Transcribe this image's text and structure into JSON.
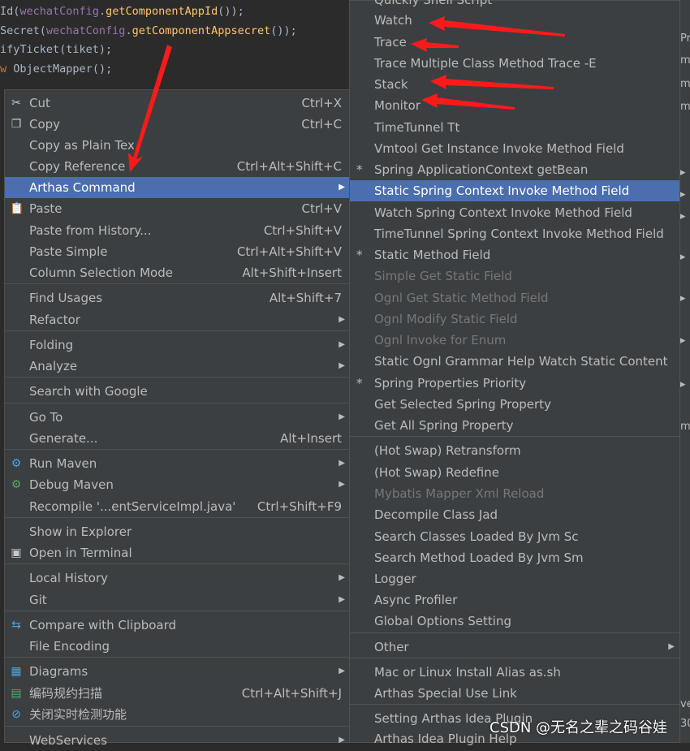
{
  "editor": {
    "lines": [
      {
        "pre": "Id(",
        "field": "wechatConfig",
        "mid": ".",
        "fn": "getComponentAppId",
        "post": "());"
      },
      {
        "pre": "Secret(",
        "field": "wechatConfig",
        "mid": ".",
        "fn": "getComponentAppsecret",
        "post": "());"
      },
      {
        "pre": "ifyTicket(tiket);",
        "field": "",
        "mid": "",
        "fn": "",
        "post": ""
      },
      {
        "pre": "",
        "kw": "w ",
        "field": "",
        "mid": "ObjectMapper",
        "fn": "",
        "post": "();"
      }
    ]
  },
  "main_menu": {
    "items": [
      {
        "label": "Cut",
        "shortcut": "Ctrl+X",
        "icon": "scissors-icon"
      },
      {
        "label": "Copy",
        "shortcut": "Ctrl+C",
        "icon": "copy-icon"
      },
      {
        "label": "Copy as Plain Tex",
        "shortcut": ""
      },
      {
        "label": "Copy Reference",
        "shortcut": "Ctrl+Alt+Shift+C"
      },
      {
        "label": "Arthas Command",
        "shortcut": "",
        "submenu": true,
        "selected": true
      },
      {
        "label": "Paste",
        "shortcut": "Ctrl+V",
        "icon": "clipboard-icon"
      },
      {
        "label": "Paste from History...",
        "shortcut": "Ctrl+Shift+V"
      },
      {
        "label": "Paste Simple",
        "shortcut": "Ctrl+Alt+Shift+V"
      },
      {
        "label": "Column Selection Mode",
        "shortcut": "Alt+Shift+Insert"
      },
      {
        "label": "Find Usages",
        "shortcut": "Alt+Shift+7"
      },
      {
        "label": "Refactor",
        "shortcut": "",
        "submenu": true
      },
      {
        "label": "Folding",
        "shortcut": "",
        "submenu": true
      },
      {
        "label": "Analyze",
        "shortcut": "",
        "submenu": true
      },
      {
        "label": "Search with Google",
        "shortcut": ""
      },
      {
        "label": "Go To",
        "shortcut": "",
        "submenu": true
      },
      {
        "label": "Generate...",
        "shortcut": "Alt+Insert"
      },
      {
        "label": "Run Maven",
        "shortcut": "",
        "submenu": true,
        "icon": "maven-gear-icon"
      },
      {
        "label": "Debug Maven",
        "shortcut": "",
        "submenu": true,
        "icon": "maven-debug-icon"
      },
      {
        "label": "Recompile '...entServiceImpl.java'",
        "shortcut": "Ctrl+Shift+F9"
      },
      {
        "label": "Show in Explorer",
        "shortcut": ""
      },
      {
        "label": "Open in Terminal",
        "shortcut": "",
        "icon": "terminal-icon"
      },
      {
        "label": "Local History",
        "shortcut": "",
        "submenu": true
      },
      {
        "label": "Git",
        "shortcut": "",
        "submenu": true
      },
      {
        "label": "Compare with Clipboard",
        "shortcut": "",
        "icon": "compare-icon"
      },
      {
        "label": "File Encoding",
        "shortcut": ""
      },
      {
        "label": "Diagrams",
        "shortcut": "",
        "submenu": true,
        "icon": "diagram-icon"
      },
      {
        "label": "编码规约扫描",
        "shortcut": "Ctrl+Alt+Shift+J",
        "icon": "scan-icon"
      },
      {
        "label": "关闭实时检测功能",
        "shortcut": "",
        "icon": "disable-icon"
      },
      {
        "label": "WebServices",
        "shortcut": "",
        "submenu": true
      }
    ]
  },
  "sub_menu": {
    "items": [
      {
        "label": "Quickly Shell Script"
      },
      {
        "label": "Watch"
      },
      {
        "label": "Trace"
      },
      {
        "label": "Trace Multiple Class Method Trace -E"
      },
      {
        "label": "Stack"
      },
      {
        "label": "Monitor"
      },
      {
        "label": "TimeTunnel Tt"
      },
      {
        "label": "Vmtool Get Instance Invoke Method Field"
      },
      {
        "label": "Spring ApplicationContext getBean",
        "star": true
      },
      {
        "label": "Static Spring Context Invoke  Method Field",
        "selected": true
      },
      {
        "label": "Watch Spring Context Invoke Method Field"
      },
      {
        "label": "TimeTunnel Spring Context Invoke Method Field"
      },
      {
        "label": "Static Method Field",
        "star": true
      },
      {
        "label": "Simple Get Static Field",
        "disabled": true
      },
      {
        "label": "Ognl Get Static Method Field",
        "disabled": true
      },
      {
        "label": "Ognl Modify Static Field",
        "disabled": true
      },
      {
        "label": "Ognl Invoke for Enum",
        "disabled": true
      },
      {
        "label": "Static Ognl Grammar Help Watch Static Content"
      },
      {
        "label": "Spring Properties Priority",
        "star": true
      },
      {
        "label": "Get Selected Spring Property"
      },
      {
        "label": "Get All Spring Property"
      },
      {
        "label": "(Hot Swap) Retransform"
      },
      {
        "label": "(Hot Swap) Redefine"
      },
      {
        "label": "Mybatis Mapper Xml Reload",
        "disabled": true
      },
      {
        "label": "Decompile Class Jad"
      },
      {
        "label": "Search Classes Loaded By Jvm Sc"
      },
      {
        "label": "Search Method Loaded By Jvm Sm"
      },
      {
        "label": "Logger"
      },
      {
        "label": "Async Profiler"
      },
      {
        "label": "Global Options Setting"
      },
      {
        "label": "Other",
        "submenu": true
      },
      {
        "label": "Mac or Linux Install Alias as.sh"
      },
      {
        "label": "Arthas Special Use Link"
      },
      {
        "label": "Setting Arthas Idea Plugin"
      },
      {
        "label": "Arthas Idea Plugin Help"
      }
    ]
  },
  "watermark": "CSDN @无名之辈之码谷娃",
  "colors": {
    "selection": "#4b6eaf",
    "menu_bg": "#3c3f41",
    "annotation": "#ff1a1a"
  }
}
